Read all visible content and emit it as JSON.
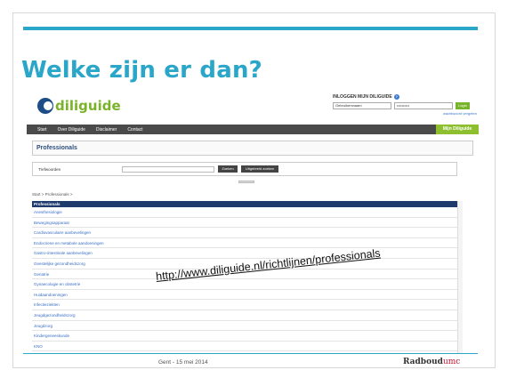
{
  "slide": {
    "title": "Welke zijn er dan?",
    "url_overlay": "http://www.diliguide.nl/richtlijnen/professionals",
    "footer_date": "Gent - 15 mei 2014",
    "footer_logo_main": "Radboud",
    "footer_logo_sub": "umc"
  },
  "site": {
    "logo_text": "diliguide",
    "login": {
      "title": "INLOGGEN MIJN DILIGUIDE",
      "username_value": "Gebruikersnaam",
      "password_value": "••••••••••",
      "login_button": "Login",
      "forgot_link": "wachtwoord vergeten"
    },
    "nav": {
      "items": [
        "Start",
        "Over Diliguide",
        "Disclaimer",
        "Contact"
      ],
      "my_diliguide": "Mijn Diliguide"
    },
    "page_title": "Professionals",
    "search": {
      "label": "Trefwoorden",
      "search_button": "Zoeken",
      "advanced_button": "Uitgebreid zoeken"
    },
    "breadcrumb": "Start > Professionals >",
    "list_header": "Professionals",
    "list_items": [
      "Anesthesiologie",
      "Bewegingsapparaat",
      "Cardiovasculaire aanbevelingen",
      "Endocriene en metabole aandoeningen",
      "Gastro-intestinale aanbevelingen",
      "Geestelijke gezondheidszorg",
      "Geriatrie",
      "Gynaecologie en obstetrie",
      "Huidaandoeningen",
      "Infectieziekten",
      "Jeugdgezondheidszorg",
      "Jeugdzorg",
      "Kindergeneeskunde",
      "KNO"
    ]
  },
  "colors": {
    "accent": "#2aa6c9",
    "brand_green": "#8dbf2f",
    "nav_dark": "#4a4a4a",
    "list_header": "#1f3b6e",
    "link_blue": "#3a6fc4"
  }
}
